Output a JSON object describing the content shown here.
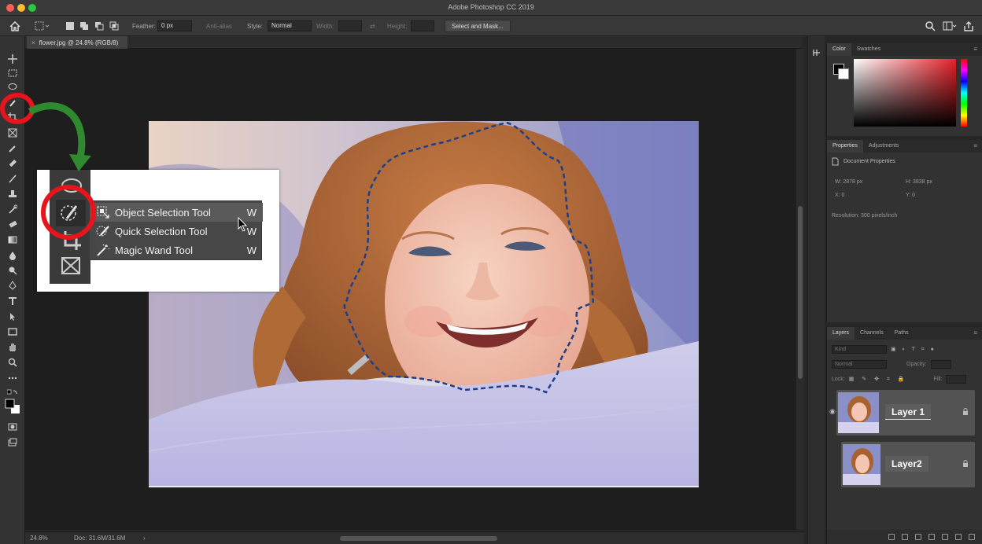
{
  "window": {
    "title": "Adobe Photoshop CC 2019"
  },
  "options_bar": {
    "feather_label": "Feather:",
    "feather_value": "0 px",
    "anti_alias_label": "Anti-alias",
    "style_label": "Style:",
    "style_value": "Normal",
    "width_label": "Width:",
    "height_label": "Height:",
    "select_mask_label": "Select and Mask..."
  },
  "document_tab": {
    "label": "flower.jpg @ 24.8% (RGB/8)"
  },
  "flyout_menu": {
    "items": [
      {
        "label": "Object Selection Tool",
        "shortcut": "W"
      },
      {
        "label": "Quick Selection Tool",
        "shortcut": "W"
      },
      {
        "label": "Magic Wand Tool",
        "shortcut": "W"
      }
    ]
  },
  "status_bar": {
    "zoom": "24.8%",
    "doc_size": "Doc: 31.6M/31.6M"
  },
  "color_panel": {
    "tabs": [
      "Color",
      "Swatches"
    ],
    "active_tab": 0
  },
  "properties_panel": {
    "tabs": [
      "Properties",
      "Adjustments"
    ],
    "heading": "Document Properties",
    "width": "W: 2878 px",
    "height": "H: 3838 px",
    "x": "X: 0",
    "y": "Y: 0",
    "resolution": "Resolution: 300 pixels/inch"
  },
  "layers_panel": {
    "tabs": [
      "Layers",
      "Channels",
      "Paths"
    ],
    "filter_placeholder": "Kind",
    "blend_mode": "Normal",
    "opacity_label": "Opacity:",
    "lock_label": "Lock:",
    "fill_label": "Fill:",
    "layers": [
      {
        "name": "Layer 1"
      },
      {
        "name": "Layer2"
      }
    ]
  },
  "colors": {
    "annotation_red": "#e8141b",
    "annotation_green": "#2f8a2f",
    "selection_dash": "#1f3f8a"
  }
}
